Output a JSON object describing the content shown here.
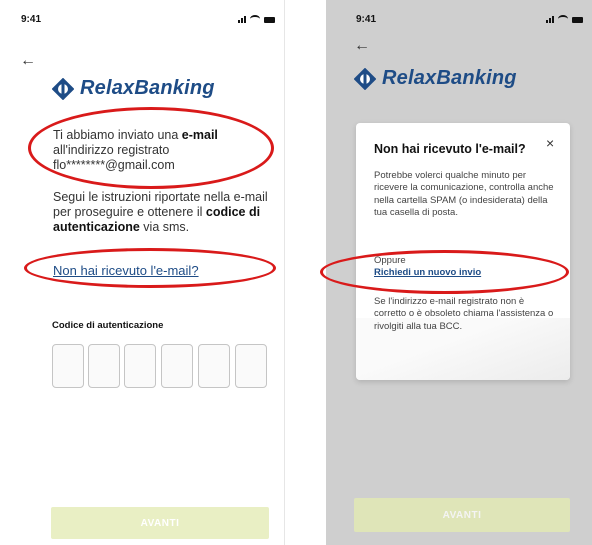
{
  "left_screen": {
    "status": {
      "time": "9:41"
    },
    "back_icon": "←",
    "logo": {
      "text_a": "Relax",
      "text_b": "Banking"
    },
    "message": {
      "line1_pre": "Ti abbiamo inviato una ",
      "line1_bold": "e-mail",
      "line2": "all'indirizzo registrato",
      "email": "flo********@gmail.com"
    },
    "instructions": {
      "pre": "Segui le istruzioni riportate nella e-mail per proseguire e ottenere il ",
      "bold": "codice di autenticazione",
      "post": " via sms."
    },
    "not_received_link": "Non hai ricevuto l'e-mail?",
    "code_label": "Codice di autenticazione",
    "code_digits": [
      "",
      "",
      "",
      "",
      "",
      ""
    ],
    "submit_label": "AVANTI"
  },
  "right_screen": {
    "status": {
      "time": "9:41"
    },
    "back_icon": "←",
    "logo": {
      "text_a": "Relax",
      "text_b": "Banking"
    },
    "modal": {
      "title": "Non hai ricevuto l'e-mail?",
      "close_icon": "×",
      "body": "Potrebbe volerci qualche minuto per ricevere la comunicazione, controlla anche nella cartella SPAM (o indesiderata) della tua casella di posta.",
      "or_label": "Oppure",
      "resend_link": "Richiedi un nuovo invio",
      "footer": "Se l'indirizzo e-mail registrato non è corretto o è obsoleto chiama l'assistenza o rivolgiti alla tua BCC."
    },
    "submit_label": "AVANTI"
  },
  "colors": {
    "brand": "#1e4c86",
    "highlight_ring": "#d91a1a",
    "button_disabled": "#e9efc4"
  }
}
